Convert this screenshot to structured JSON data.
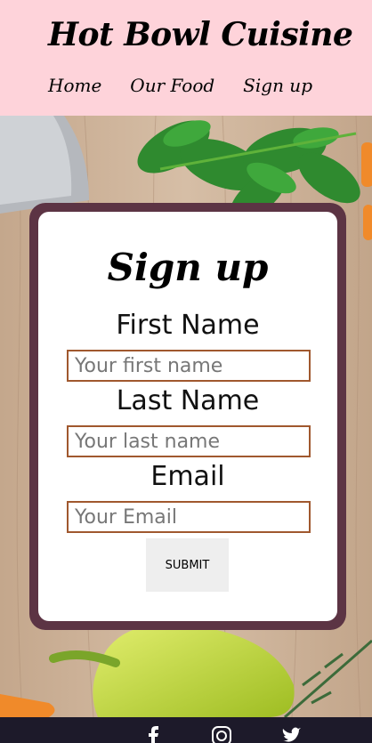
{
  "header": {
    "brand": "Hot Bowl Cuisine",
    "nav": [
      {
        "label": "Home"
      },
      {
        "label": "Our Food"
      },
      {
        "label": "Sign up"
      }
    ]
  },
  "form": {
    "title": "Sign up",
    "fields": [
      {
        "label": "First Name",
        "placeholder": "Your first name"
      },
      {
        "label": "Last Name",
        "placeholder": "Your last name"
      },
      {
        "label": "Email",
        "placeholder": "Your Email"
      }
    ],
    "submit_label": "SUBMIT"
  },
  "footer": {
    "icons": [
      "facebook-icon",
      "instagram-icon",
      "twitter-icon"
    ]
  },
  "colors": {
    "header_bg": "#fed3da",
    "card_frame": "#5c3444",
    "input_border": "#a0582e",
    "footer_bg": "#1d1a2a"
  }
}
